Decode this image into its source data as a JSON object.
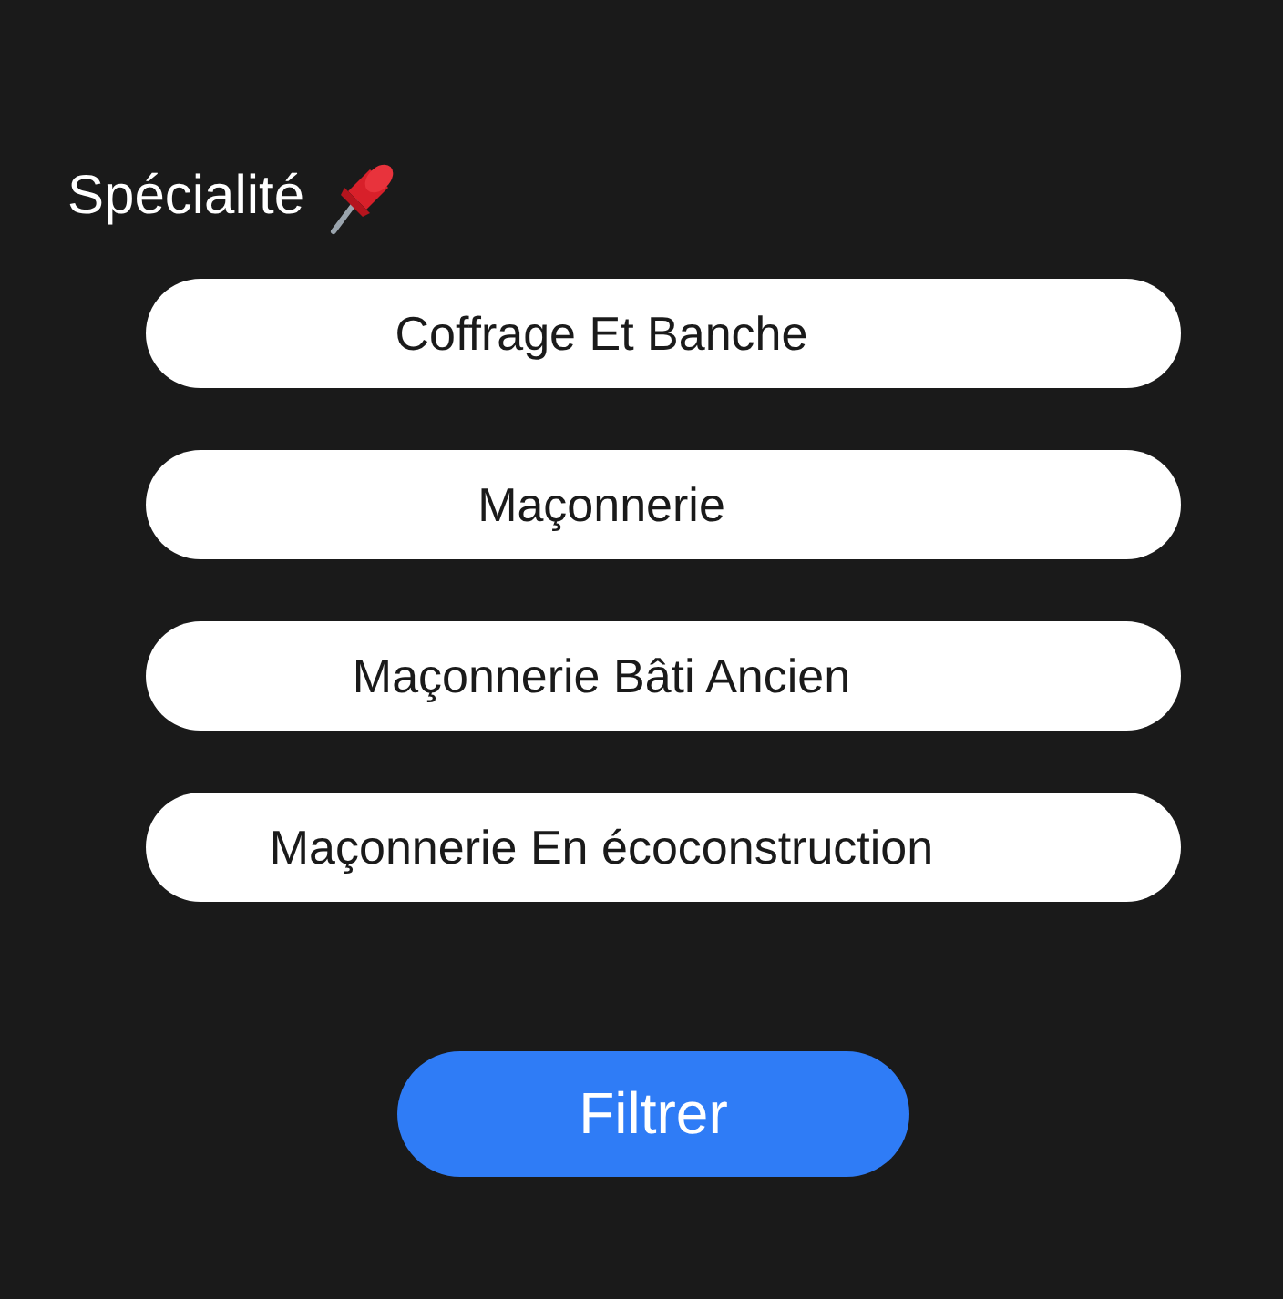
{
  "filter": {
    "title": "Spécialité",
    "options": [
      {
        "label": "Coffrage Et Banche"
      },
      {
        "label": "Maçonnerie"
      },
      {
        "label": "Maçonnerie Bâti Ancien"
      },
      {
        "label": "Maçonnerie En écoconstruction"
      }
    ],
    "button": "Filtrer"
  }
}
